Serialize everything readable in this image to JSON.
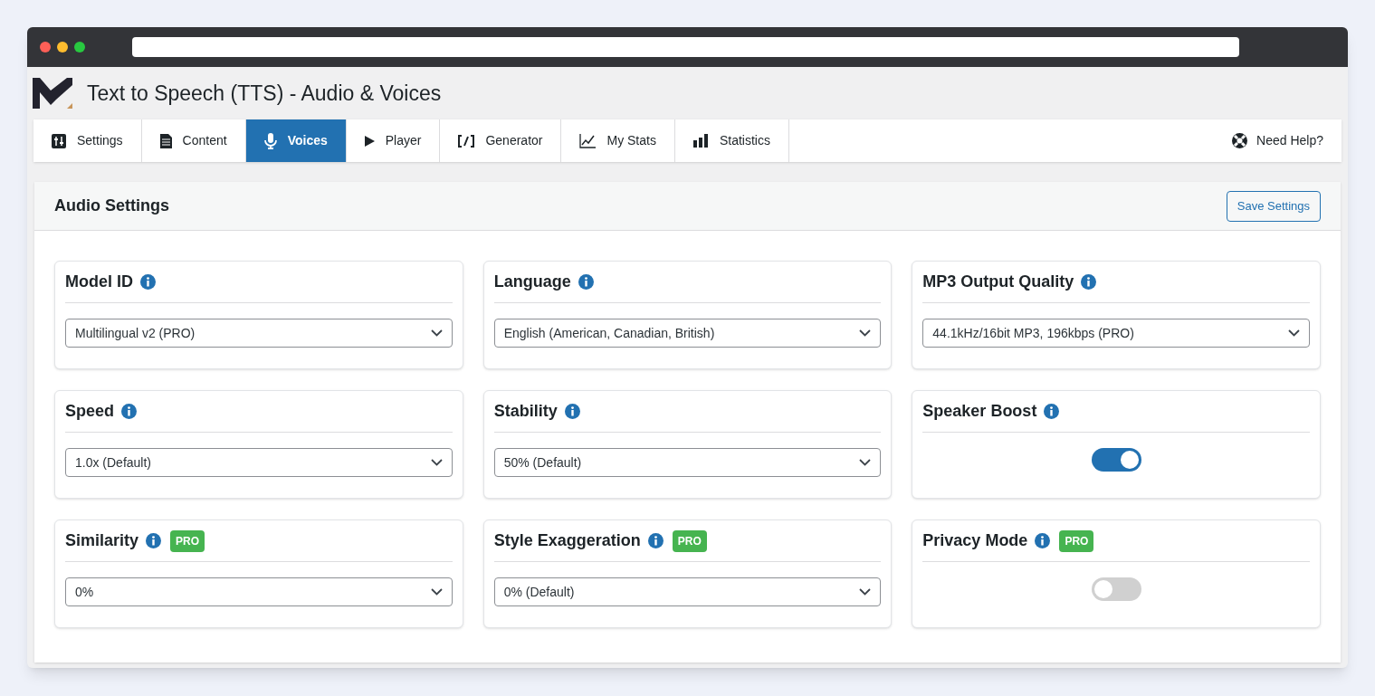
{
  "app": {
    "title": "Text to Speech (TTS) - Audio & Voices"
  },
  "tabs": [
    {
      "label": "Settings",
      "selected": false
    },
    {
      "label": "Content",
      "selected": false
    },
    {
      "label": "Voices",
      "selected": true
    },
    {
      "label": "Player",
      "selected": false
    },
    {
      "label": "Generator",
      "selected": false
    },
    {
      "label": "My Stats",
      "selected": false
    },
    {
      "label": "Statistics",
      "selected": false
    }
  ],
  "help_link": "Need Help?",
  "panel": {
    "title": "Audio Settings",
    "save_button": "Save Settings"
  },
  "settings": [
    {
      "kind": "select",
      "label": "Model ID",
      "value": "Multilingual v2 (PRO)"
    },
    {
      "kind": "select",
      "label": "Language",
      "value": "English (American, Canadian, British)"
    },
    {
      "kind": "select",
      "label": "MP3 Output Quality",
      "value": "44.1kHz/16bit MP3, 196kbps (PRO)"
    },
    {
      "kind": "select",
      "label": "Speed",
      "value": "1.0x (Default)"
    },
    {
      "kind": "select",
      "label": "Stability",
      "value": "50% (Default)"
    },
    {
      "kind": "toggle",
      "label": "Speaker Boost",
      "on": true
    },
    {
      "kind": "select",
      "label": "Similarity",
      "badge": "PRO",
      "value": "0%"
    },
    {
      "kind": "select",
      "label": "Style Exaggeration",
      "badge": "PRO",
      "value": "0% (Default)"
    },
    {
      "kind": "toggle",
      "label": "Privacy Mode",
      "badge": "PRO",
      "on": false
    }
  ]
}
